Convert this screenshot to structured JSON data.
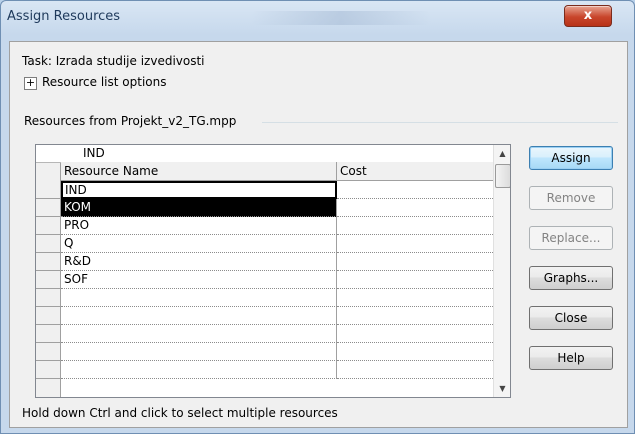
{
  "window": {
    "title": "Assign Resources",
    "close_glyph": "x"
  },
  "task": {
    "line": "Task: Izrada studije izvedivosti"
  },
  "options": {
    "expand_glyph": "+",
    "label": "Resource list options"
  },
  "group": {
    "label": "Resources from Projekt_v2_TG.mpp"
  },
  "grid": {
    "edit_value": "IND",
    "columns": [
      "Resource Name",
      "Cost"
    ],
    "rows": [
      {
        "name": "IND",
        "cost": ""
      },
      {
        "name": "KOM",
        "cost": ""
      },
      {
        "name": "PRO",
        "cost": ""
      },
      {
        "name": "Q",
        "cost": ""
      },
      {
        "name": "R&D",
        "cost": ""
      },
      {
        "name": "SOF",
        "cost": ""
      },
      {
        "name": "",
        "cost": ""
      },
      {
        "name": "",
        "cost": ""
      },
      {
        "name": "",
        "cost": ""
      },
      {
        "name": "",
        "cost": ""
      },
      {
        "name": "",
        "cost": ""
      }
    ],
    "scroll_up_glyph": "▲",
    "scroll_down_glyph": "▼"
  },
  "buttons": {
    "assign": "Assign",
    "remove": "Remove",
    "replace": "Replace...",
    "graphs": "Graphs...",
    "close": "Close",
    "help": "Help"
  },
  "hint": "Hold down Ctrl and click to select multiple resources"
}
